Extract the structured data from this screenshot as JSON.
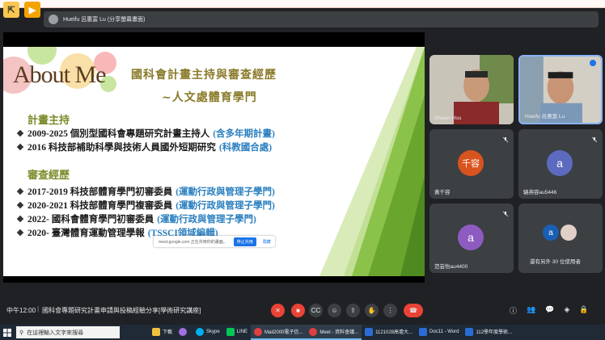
{
  "presenter_bar": {
    "label": "Hueifu 呂惠富 Lu (分享螢幕畫面)"
  },
  "slide": {
    "title": "About Me",
    "heading1": "國科會計畫主持與審查經歷",
    "heading2": "~人文處體育學門",
    "section1": "計畫主持",
    "section1_items": [
      {
        "text": "2009-2025 個別型國科會專題研究計畫主持人",
        "note": "(含多年期計畫)"
      },
      {
        "text": "2016 科技部補助科學與技術人員國外短期研究",
        "note": "(科教國合處)"
      }
    ],
    "section2": "審查經歷",
    "section2_items": [
      {
        "text": "2017-2019 科技部體育學門初審委員",
        "note": "(運動行政與管理子學門)"
      },
      {
        "text": "2020-2021 科技部體育學門複審委員",
        "note": "(運動行政與管理子學門)"
      },
      {
        "text": "2022-  國科會體育學門初審委員",
        "note": "(運動行政與管理子學門)"
      },
      {
        "text": "2020- 臺灣體育運動管理學報",
        "note": "(TSSCI領域編輯)"
      }
    ]
  },
  "share_banner": {
    "message": "meet.google.com 正在共用你的畫面。",
    "stop_label": "停止共用",
    "hide_label": "隱藏"
  },
  "participants": [
    {
      "name": "Shawn Hsu",
      "type": "video"
    },
    {
      "name": "Hueifu 呂惠富 Lu",
      "type": "video"
    },
    {
      "name": "黃千容",
      "type": "avatar",
      "initial": "千容",
      "color": "#d9531e"
    },
    {
      "name": "駱燕容au5446",
      "type": "avatar",
      "initial": "a",
      "color": "#5c6bc0"
    },
    {
      "name": "范芸怡au4400",
      "type": "avatar",
      "initial": "a",
      "color": "#8e5cc0"
    },
    {
      "name": "還有另外 30 位使用者",
      "type": "others",
      "initial": "a",
      "color": "#1a5fb4"
    }
  ],
  "bottom": {
    "time": "中午12:00",
    "meeting_title": "國科會專題研究計畫申請與投稿經驗分享[學術研究講座]"
  },
  "taskbar": {
    "search_placeholder": "在這裡輸入文字來搜尋",
    "items": [
      {
        "label": "下載",
        "color": "#f0c040"
      },
      {
        "label": "",
        "color": "#a070e0"
      },
      {
        "label": "Skype",
        "color": "#00aff0"
      },
      {
        "label": "LINE",
        "color": "#06c755"
      },
      {
        "label": "Mail2000電子信...",
        "color": "#e04040"
      },
      {
        "label": "Meet - 資料會議...",
        "color": "#e04040"
      },
      {
        "label": "1121028高壇大...",
        "color": "#2b6cd4"
      },
      {
        "label": "Doc11 - Word",
        "color": "#2b6cd4"
      },
      {
        "label": "112學年度學術...",
        "color": "#2b6cd4"
      }
    ]
  },
  "colors": {
    "accent": "#1a73e8",
    "end_call": "#ea4335",
    "slide_green": "#8bc34a"
  }
}
